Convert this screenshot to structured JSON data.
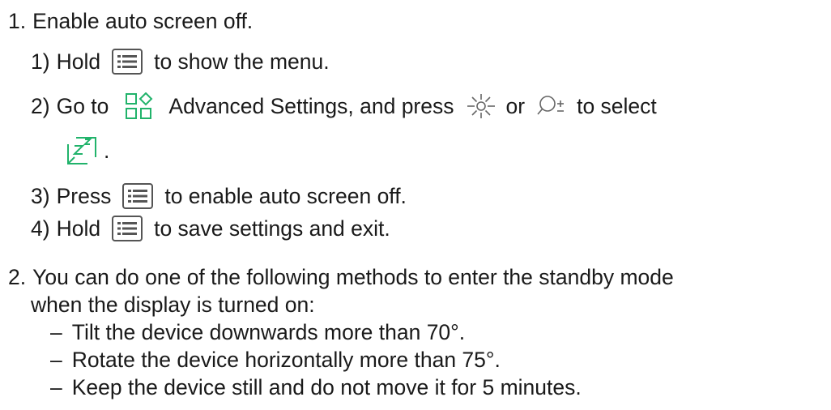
{
  "step1": {
    "number": "1.",
    "text": "Enable auto screen off.",
    "substeps": [
      {
        "number": "1)",
        "pre": "Hold",
        "post": "to show the menu."
      },
      {
        "number": "2)",
        "pre": "Go to",
        "mid": "Advanced Settings, and press",
        "or": "or",
        "post": "to select",
        "end": "."
      },
      {
        "number": "3)",
        "pre": "Press",
        "post": "to enable auto screen off."
      },
      {
        "number": "4)",
        "pre": "Hold",
        "post": "to save settings and exit."
      }
    ]
  },
  "step2": {
    "number": "2.",
    "text_line1": "You can do one of the following methods to enter the standby mode",
    "text_line2": "when the display is turned on:",
    "bullets": [
      "Tilt the device downwards more than 70°.",
      "Rotate the device horizontally more than 75°.",
      "Keep the device still and do not move it for 5 minutes."
    ],
    "bullet_marker": "–"
  },
  "icons": {
    "menu": "menu-button-icon",
    "advanced_settings": "advanced-settings-icon",
    "brightness": "brightness-icon",
    "zoom": "zoom-icon",
    "auto_screen_off": "auto-screen-off-icon"
  },
  "colors": {
    "text": "#1a1a1a",
    "icon_gray": "#555555",
    "icon_green": "#21b36b"
  }
}
